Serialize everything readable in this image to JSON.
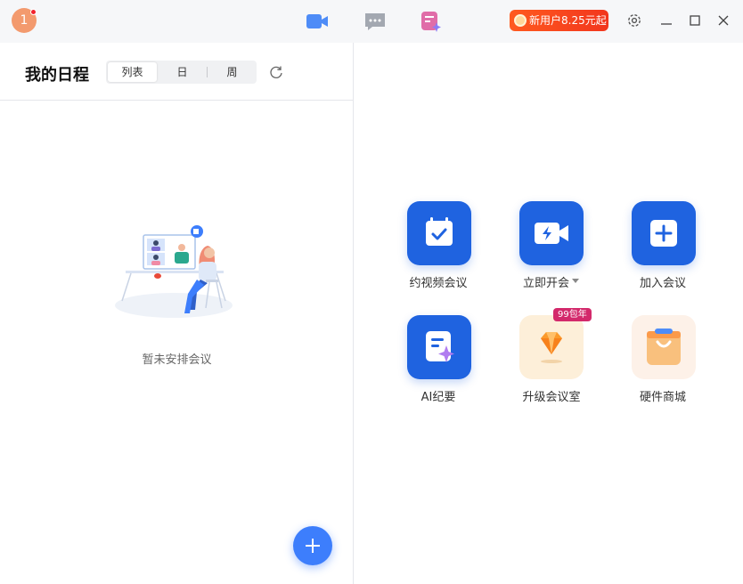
{
  "titlebar": {
    "avatar_text": "1",
    "promo_text": "新用户8.25元起",
    "icons": [
      "video-icon",
      "chat-icon",
      "ai-notes-icon",
      "settings-icon",
      "minimize-icon",
      "maximize-icon",
      "close-icon"
    ]
  },
  "schedule": {
    "title": "我的日程",
    "view_tabs": [
      {
        "label": "列表",
        "active": true
      },
      {
        "label": "日",
        "active": false
      },
      {
        "label": "周",
        "active": false
      }
    ],
    "empty_text": "暂未安排会议"
  },
  "actions": [
    {
      "label": "约视频会议",
      "icon": "calendar-check-icon"
    },
    {
      "label": "立即开会",
      "icon": "video-camera-icon",
      "has_dropdown": true
    },
    {
      "label": "加入会议",
      "icon": "plus-square-icon"
    },
    {
      "label": "AI纪要",
      "icon": "ai-notes-icon"
    },
    {
      "label": "升级会议室",
      "icon": "diamond-icon",
      "badge": "99包年"
    },
    {
      "label": "硬件商城",
      "icon": "shopping-bag-icon"
    }
  ],
  "colors": {
    "primary": "#1f63e0",
    "fab": "#3d7efc",
    "promo": "#f2361d",
    "badge": "#d3296b",
    "avatar": "#f39a6e"
  }
}
